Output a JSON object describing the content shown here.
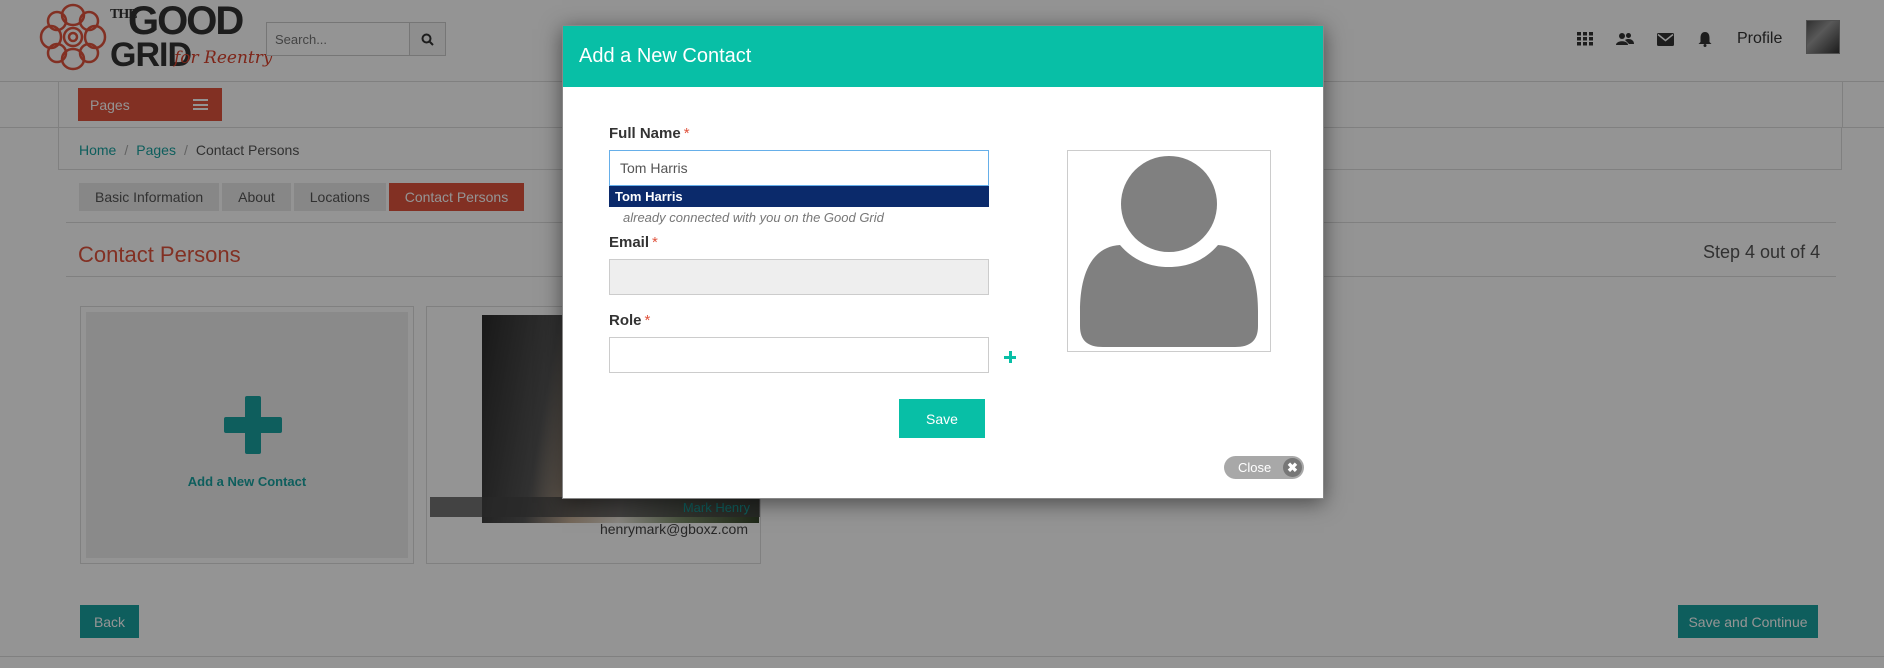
{
  "header": {
    "logo": {
      "line1": "THE",
      "line2": "GOOD",
      "line3": "GRID",
      "tagline": "for Reentry"
    },
    "search": {
      "placeholder": "Search..."
    },
    "nav": {
      "icons": [
        "apps-grid-icon",
        "people-icon",
        "mail-icon",
        "bell-icon"
      ],
      "profile_label": "Profile"
    }
  },
  "pages_button": {
    "label": "Pages"
  },
  "breadcrumb": [
    "Home",
    "Pages",
    "Contact Persons"
  ],
  "tabs": [
    "Basic Information",
    "About",
    "Locations",
    "Contact Persons"
  ],
  "active_tab": "Contact Persons",
  "section": {
    "title": "Contact Persons",
    "step": "Step 4 out of 4"
  },
  "cards": {
    "add_label": "Add a New Contact",
    "contact": {
      "name": "Mark Henry",
      "email": "henrymark@gboxz.com"
    }
  },
  "footer_buttons": {
    "back": "Back",
    "save_continue": "Save and Continue"
  },
  "modal": {
    "title": "Add a New Contact",
    "full_name_label": "Full Name",
    "full_name_value": "Tom Harris",
    "suggestion": "Tom Harris",
    "hint": "already connected with you on the Good Grid",
    "email_label": "Email",
    "email_value": "",
    "role_label": "Role",
    "role_value": "",
    "required_mark": "*",
    "save_label": "Save",
    "close_label": "Close",
    "close_icon_glyph": "✖"
  },
  "colors": {
    "accent_teal": "#08bfa6",
    "brand_red": "#e0533d",
    "suggest_bg": "#0b2a6b"
  }
}
